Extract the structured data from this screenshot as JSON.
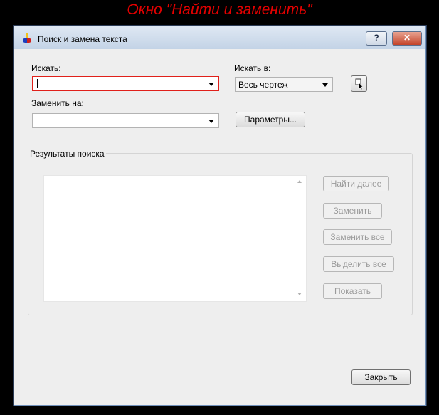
{
  "banner": {
    "text": "Окно \"Найти и заменить\""
  },
  "window": {
    "title": "Поиск и замена текста",
    "help_label": "?",
    "close_label": "✕"
  },
  "find": {
    "label": "Искать:",
    "value": ""
  },
  "replace": {
    "label": "Заменить на:",
    "value": ""
  },
  "scope": {
    "label": "Искать в:",
    "value": "Весь чертеж"
  },
  "buttons": {
    "params": "Параметры...",
    "find_next": "Найти далее",
    "replace": "Заменить",
    "replace_all": "Заменить все",
    "select_all": "Выделить все",
    "zoom": "Показать",
    "close": "Закрыть"
  },
  "results": {
    "title": "Результаты поиска"
  },
  "colors": {
    "banner": "#e30000",
    "active_border": "#e0201a"
  }
}
